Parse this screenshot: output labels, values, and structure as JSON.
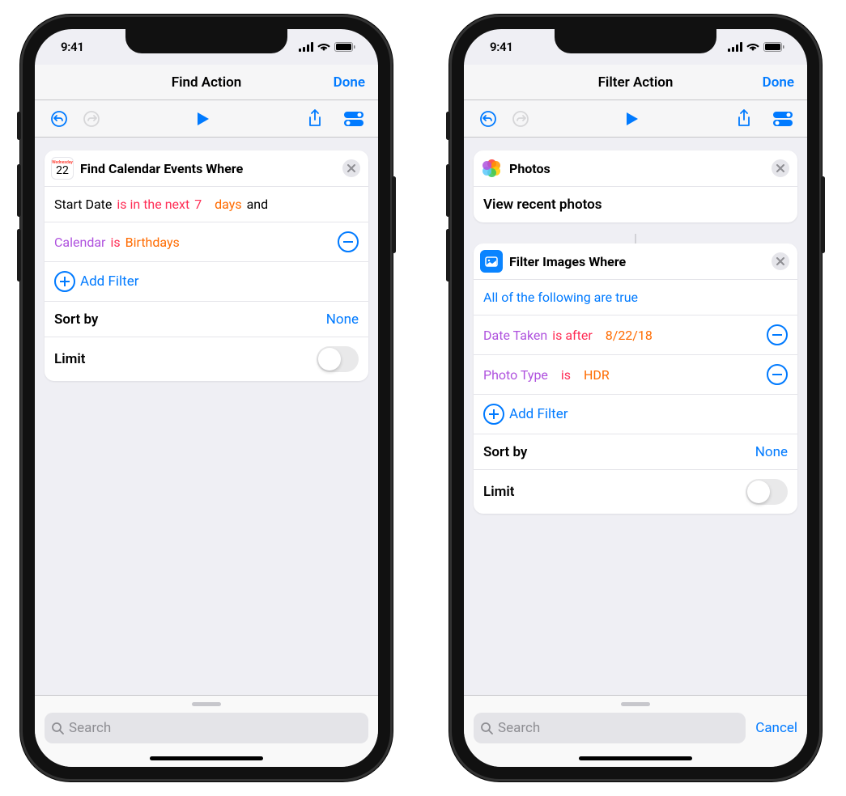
{
  "status": {
    "time": "9:41"
  },
  "phone1": {
    "nav": {
      "title": "Find Action",
      "done": "Done"
    },
    "card1": {
      "title": "Find Calendar Events Where",
      "cal_day": "22",
      "cal_label": "Wednesday",
      "row1": {
        "field": "Start Date",
        "op": "is in the next",
        "num": "7",
        "unit": "days",
        "tail": "and"
      },
      "row2": {
        "field": "Calendar",
        "op": "is",
        "val": "Birthdays"
      },
      "add_filter": "Add Filter",
      "sort_label": "Sort by",
      "sort_value": "None",
      "limit_label": "Limit"
    },
    "search_placeholder": "Search"
  },
  "phone2": {
    "nav": {
      "title": "Filter Action",
      "done": "Done"
    },
    "card_photos": {
      "title": "Photos",
      "action": "View recent photos"
    },
    "card_filter": {
      "title": "Filter Images Where",
      "cond": "All of the following are true",
      "row1": {
        "field": "Date Taken",
        "op": "is after",
        "val": "8/22/18"
      },
      "row2": {
        "field": "Photo Type",
        "op": "is",
        "val": "HDR"
      },
      "add_filter": "Add Filter",
      "sort_label": "Sort by",
      "sort_value": "None",
      "limit_label": "Limit"
    },
    "search_placeholder": "Search",
    "cancel": "Cancel"
  }
}
